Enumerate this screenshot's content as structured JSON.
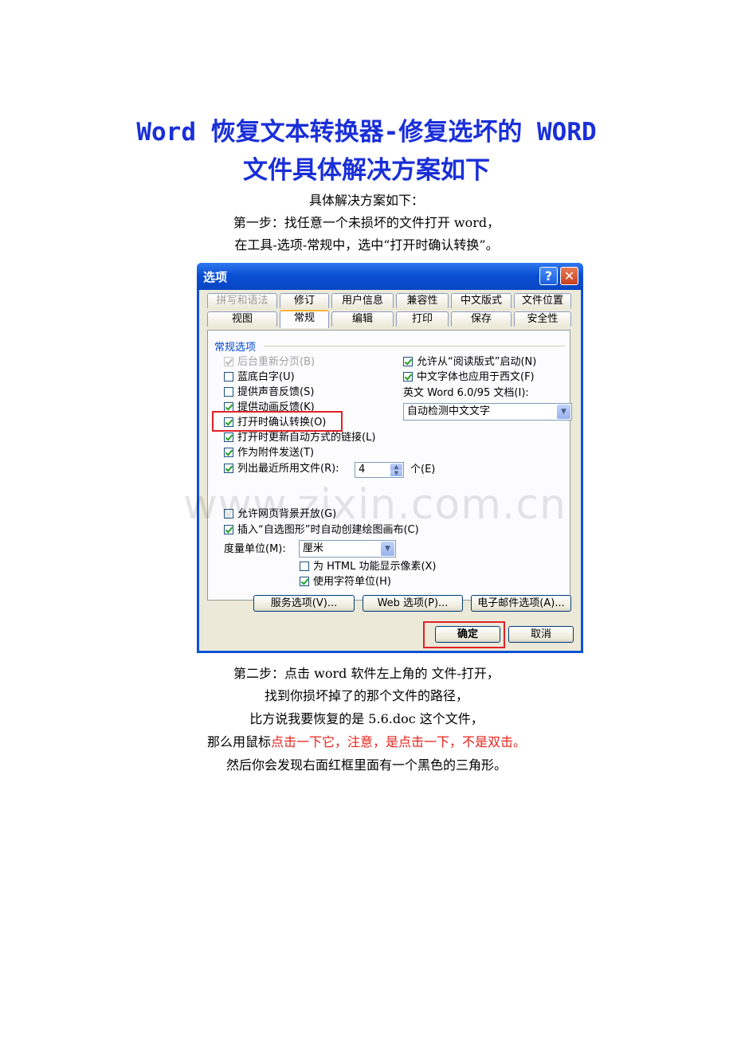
{
  "title": {
    "line1": "Word 恢复文本转换器-修复选坏的 WORD",
    "line2": "文件具体解决方案如下"
  },
  "intro": [
    "具体解决方案如下：",
    "第一步：找任意一个未损坏的文件打开 word，",
    "在工具-选项-常规中，选中“打开时确认转换”。"
  ],
  "dialog": {
    "title": "选项",
    "help_icon": "?",
    "close_icon": "✕",
    "tabs_row1": [
      "拼写和语法",
      "修订",
      "用户信息",
      "兼容性",
      "中文版式",
      "文件位置"
    ],
    "tabs_row2": [
      "视图",
      "常规",
      "编辑",
      "打印",
      "保存",
      "安全性"
    ],
    "active_tab": "常规",
    "group_label": "常规选项",
    "left_options": [
      {
        "label": "后台重新分页(B)",
        "checked": true,
        "disabled": true
      },
      {
        "label": "蓝底白字(U)",
        "checked": false,
        "disabled": false
      },
      {
        "label": "提供声音反馈(S)",
        "checked": false,
        "disabled": false
      },
      {
        "label": "提供动画反馈(K)",
        "checked": true,
        "disabled": false
      },
      {
        "label": "打开时确认转换(O)",
        "checked": true,
        "disabled": false
      },
      {
        "label": "打开时更新自动方式的链接(L)",
        "checked": true,
        "disabled": false
      },
      {
        "label": "作为附件发送(T)",
        "checked": true,
        "disabled": false
      },
      {
        "label": "列出最近所用文件(R):",
        "checked": true,
        "disabled": false
      }
    ],
    "recent_files_count": "4",
    "recent_files_unit": "个(E)",
    "right_options": [
      {
        "label": "允许从“阅读版式”启动(N)",
        "checked": true
      },
      {
        "label": "中文字体也应用于西文(F)",
        "checked": true
      }
    ],
    "word_version_label": "英文 Word 6.0/95 文档(I):",
    "word_version_value": "自动检测中文文字",
    "lower_options": [
      {
        "label": "允许网页背景开放(G)",
        "checked": false
      },
      {
        "label": "插入“自选图形”时自动创建绘图画布(C)",
        "checked": true
      }
    ],
    "unit_label": "度量单位(M):",
    "unit_value": "厘米",
    "sub_options": [
      {
        "label": "为 HTML 功能显示像素(X)",
        "checked": false
      },
      {
        "label": "使用字符单位(H)",
        "checked": true
      }
    ],
    "buttons": {
      "service": "服务选项(V)...",
      "web": "Web 选项(P)...",
      "email": "电子邮件选项(A)...",
      "ok": "确定",
      "cancel": "取消"
    }
  },
  "watermark": "www.zixin.com.cn",
  "steps": {
    "line1": "第二步：点击 word 软件左上角的 文件-打开，",
    "line2": "找到你损坏掉了的那个文件的路径，",
    "line3": "比方说我要恢复的是 5.6.doc 这个文件，",
    "line4_black": "那么用鼠标",
    "line4_red": "点击一下它，注意，是点击一下，不是双击。",
    "line5": "然后你会发现右面红框里面有一个黑色的三角形。"
  },
  "colors": {
    "title_blue": "#1a2fd8",
    "highlight_red": "#e8221c",
    "xp_titlebar": "#0a4fd3"
  }
}
